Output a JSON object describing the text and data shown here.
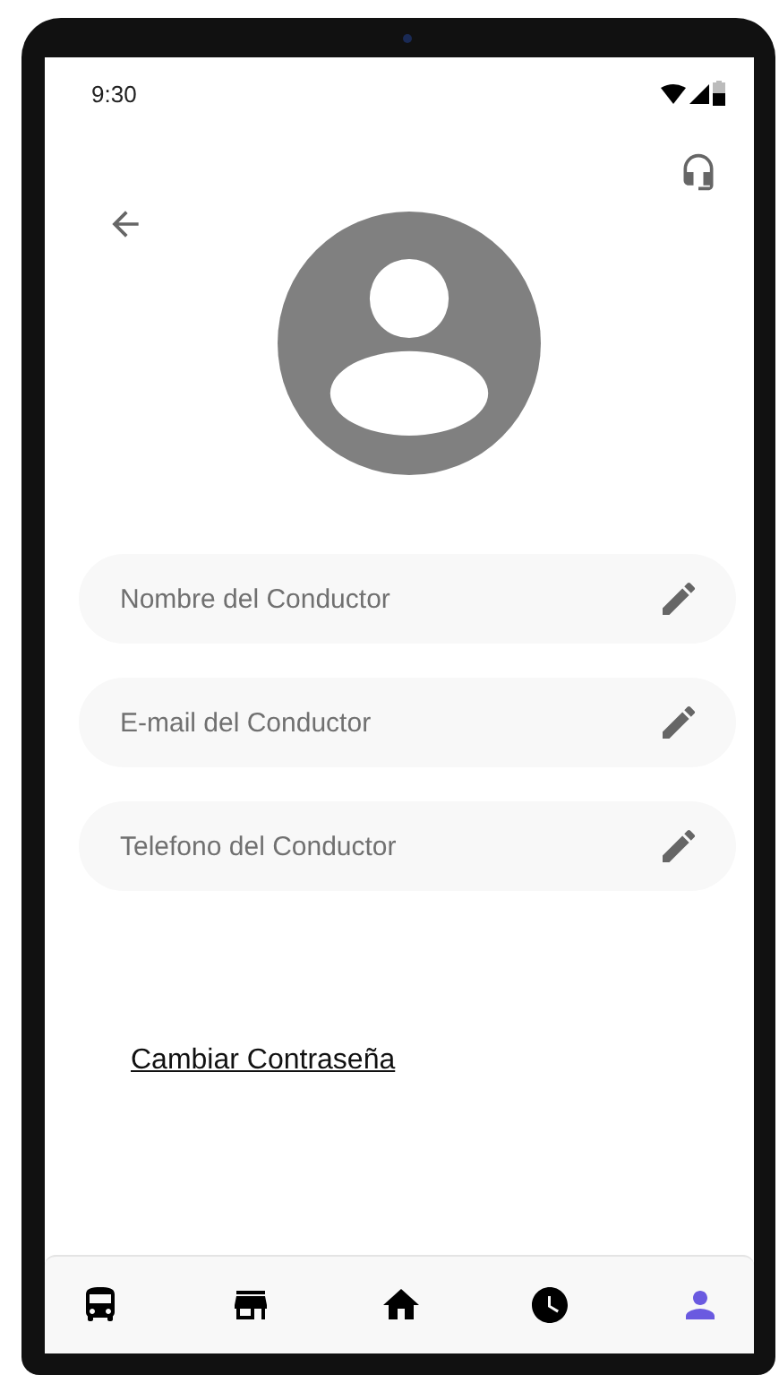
{
  "status_bar": {
    "time": "9:30"
  },
  "fields": [
    {
      "placeholder": "Nombre del Conductor"
    },
    {
      "placeholder": "E-mail del Conductor"
    },
    {
      "placeholder": "Telefono del Conductor"
    }
  ],
  "change_password_link": "Cambiar Contraseña",
  "bottom_nav": [
    {
      "kind": "bus",
      "selected": false
    },
    {
      "kind": "store",
      "selected": false
    },
    {
      "kind": "home",
      "selected": false
    },
    {
      "kind": "clock",
      "selected": false
    },
    {
      "kind": "person",
      "selected": true
    }
  ]
}
